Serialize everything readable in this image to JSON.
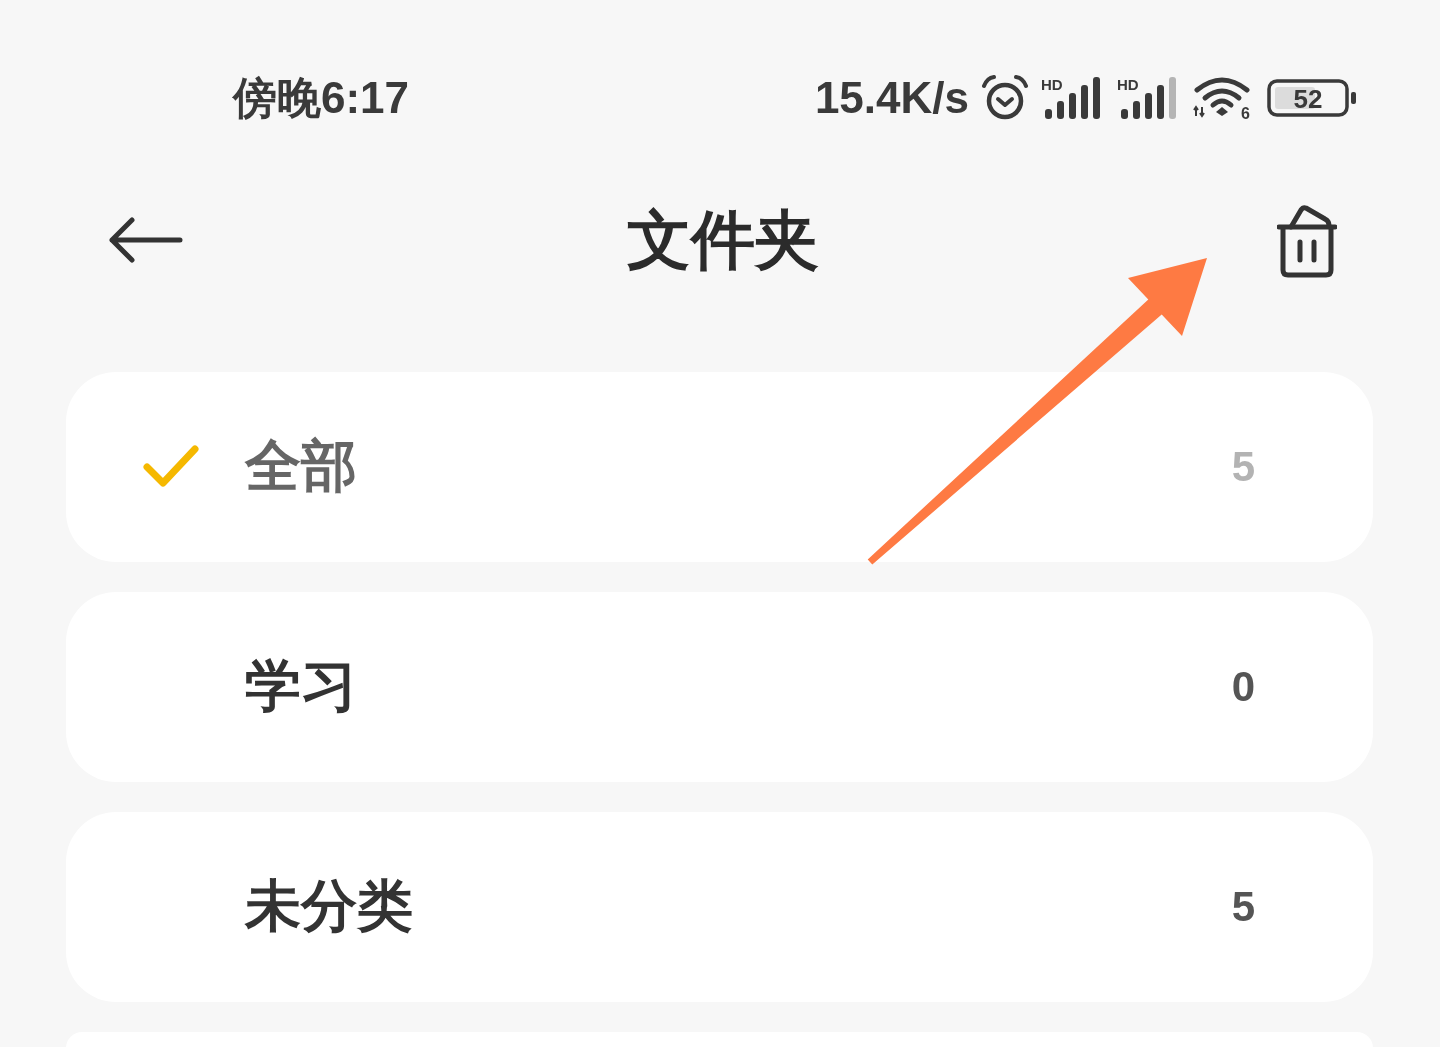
{
  "status_bar": {
    "time": "傍晚6:17",
    "net_speed": "15.4K/s",
    "signals": [
      {
        "label": "HD"
      },
      {
        "label": "HD"
      }
    ],
    "wifi": {
      "label": "6"
    },
    "battery": {
      "percent": "52"
    }
  },
  "header": {
    "title": "文件夹"
  },
  "folders": [
    {
      "name": "全部",
      "count": "5",
      "selected": true
    },
    {
      "name": "学习",
      "count": "0",
      "selected": false
    },
    {
      "name": "未分类",
      "count": "5",
      "selected": false
    }
  ]
}
